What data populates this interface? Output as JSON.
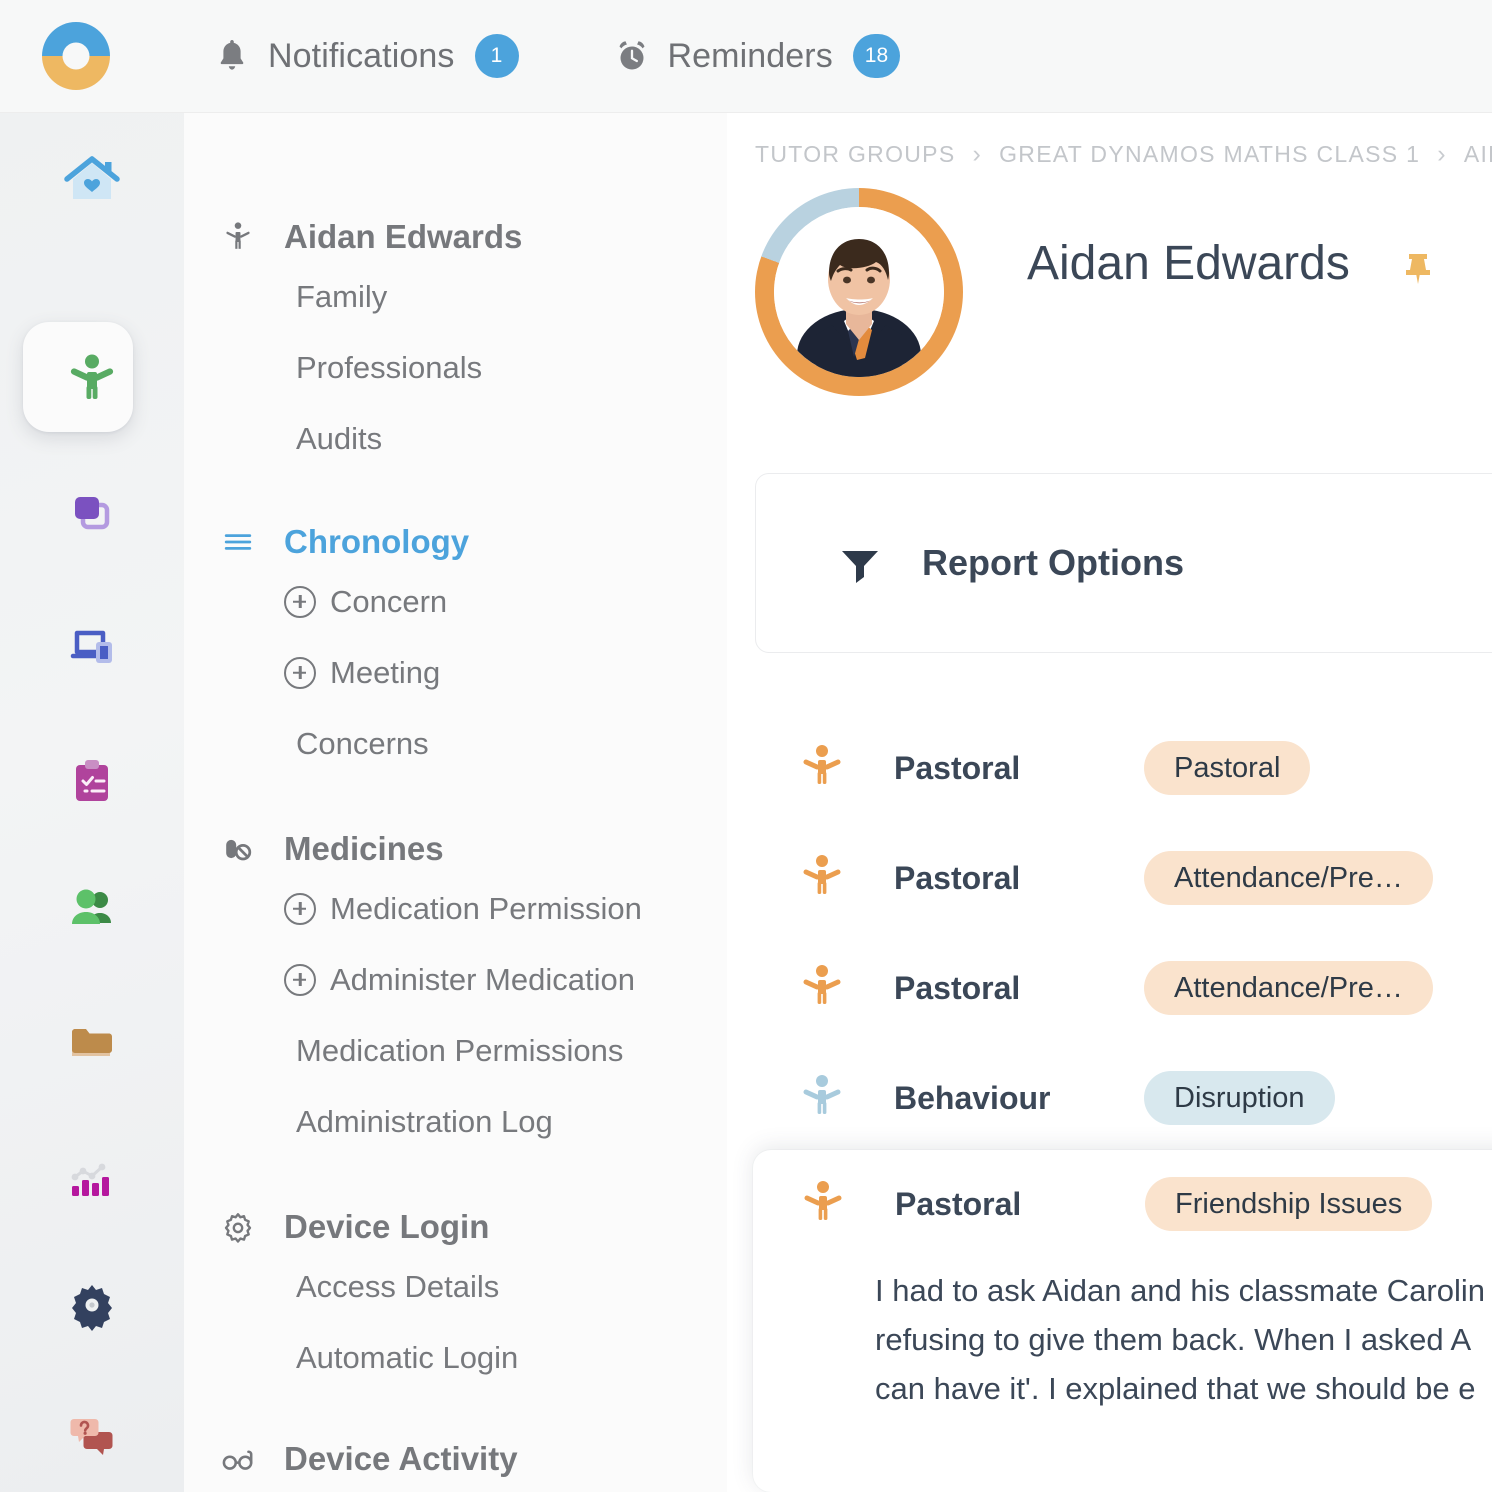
{
  "brand": {
    "logo_icon": "donut-logo",
    "blue": "#4ca3dc",
    "orange": "#eeb862"
  },
  "topbar": {
    "notifications": {
      "label": "Notifications",
      "icon": "bell-icon",
      "count": "1"
    },
    "reminders": {
      "label": "Reminders",
      "icon": "alarm-clock-icon",
      "count": "18"
    }
  },
  "rail": {
    "items": [
      {
        "name": "home",
        "icon": "home-heart-icon",
        "color": "#4ca3dc",
        "active": false
      },
      {
        "name": "pupils",
        "icon": "child-icon",
        "color": "#58ab63",
        "active": true
      },
      {
        "name": "groups",
        "icon": "overlapping-squares-icon",
        "color": "#7b51c0",
        "active": false
      },
      {
        "name": "devices",
        "icon": "devices-icon",
        "color": "#4a5ec4",
        "active": false
      },
      {
        "name": "assessments",
        "icon": "clipboard-check-icon",
        "color": "#b0439c",
        "active": false
      },
      {
        "name": "staff",
        "icon": "people-icon",
        "color": "#5dc169",
        "active": false
      },
      {
        "name": "files",
        "icon": "folders-icon",
        "color": "#bd8b4b",
        "active": false
      },
      {
        "name": "reports",
        "icon": "bar-chart-icon",
        "color": "#b5179e",
        "active": false
      },
      {
        "name": "settings",
        "icon": "gear-icon",
        "color": "#33415f",
        "active": false
      },
      {
        "name": "help",
        "icon": "question-chat-icon",
        "color": "#e8b0a0",
        "active": false
      }
    ]
  },
  "nav": {
    "groups": [
      {
        "label": "Aidan Edwards",
        "icon": "child-icon",
        "selected": false,
        "items": [
          {
            "label": "Family",
            "add": false
          },
          {
            "label": "Professionals",
            "add": false
          },
          {
            "label": "Audits",
            "add": false
          }
        ]
      },
      {
        "label": "Chronology",
        "icon": "list-lines-icon",
        "selected": true,
        "items": [
          {
            "label": "Concern",
            "add": true
          },
          {
            "label": "Meeting",
            "add": true
          },
          {
            "label": "Concerns",
            "add": false
          }
        ]
      },
      {
        "label": "Medicines",
        "icon": "pill-no-entry-icon",
        "selected": false,
        "items": [
          {
            "label": "Medication Permission",
            "add": true
          },
          {
            "label": "Administer Medication",
            "add": true
          },
          {
            "label": "Medication Permissions",
            "add": false
          },
          {
            "label": "Administration Log",
            "add": false
          }
        ]
      },
      {
        "label": "Device Login",
        "icon": "gear-icon",
        "selected": false,
        "items": [
          {
            "label": "Access Details",
            "add": false
          },
          {
            "label": "Automatic Login",
            "add": false
          }
        ]
      },
      {
        "label": "Device Activity",
        "icon": "glasses-icon",
        "selected": false,
        "items": []
      }
    ]
  },
  "main": {
    "breadcrumb": [
      "TUTOR GROUPS",
      "GREAT DYNAMOS MATHS CLASS 1",
      "AIDAN EDWARDS"
    ],
    "breadcrumb_separator": "›",
    "profile": {
      "name": "Aidan Edwards",
      "avatar_icon": "student-photo",
      "ring_progress_color": "#eb9e4f",
      "ring_remainder_color": "#b9d2e0",
      "actions": [
        {
          "name": "pin-icon",
          "color": "#eeb862"
        },
        {
          "name": "edit-pencil-icon",
          "color": "#6f7379"
        }
      ]
    },
    "report_options": {
      "label": "Report Options",
      "icon": "filter-funnel-icon"
    },
    "entries": [
      {
        "label": "Pastoral",
        "icon_color": "#eb9e4f",
        "tag": "Pastoral",
        "tag_style": "orange"
      },
      {
        "label": "Pastoral",
        "icon_color": "#eb9e4f",
        "tag": "Attendance/Pre…",
        "tag_style": "orange"
      },
      {
        "label": "Pastoral",
        "icon_color": "#eb9e4f",
        "tag": "Attendance/Pre…",
        "tag_style": "orange"
      },
      {
        "label": "Behaviour",
        "icon_color": "#a8cbdd",
        "tag": "Disruption",
        "tag_style": "blue"
      }
    ],
    "expanded_entry": {
      "label": "Pastoral",
      "icon_color": "#eb9e4f",
      "tag": "Friendship Issues",
      "tag_style": "orange",
      "body_lines": [
        "I had to ask Aidan and his classmate Carolin",
        "refusing to give them back. When I asked A",
        "can have it'. I explained that we should be e"
      ]
    }
  }
}
